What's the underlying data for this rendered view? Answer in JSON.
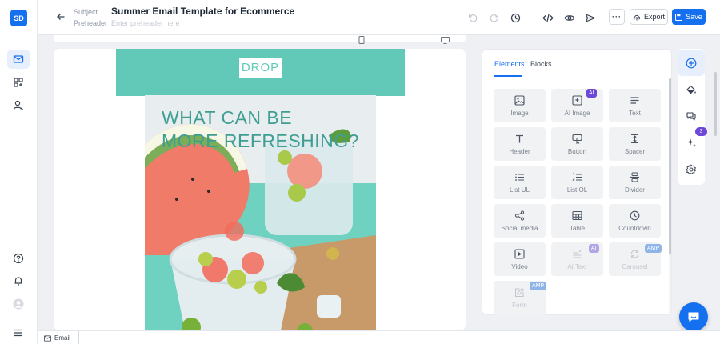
{
  "app": {
    "logo_text": "SD"
  },
  "header": {
    "subject_label": "Subject",
    "preheader_label": "Preheader",
    "title": "Summer Email Template for Ecommerce",
    "preheader_placeholder": "Enter preheader here",
    "export_label": "Export",
    "save_label": "Save",
    "more_label": "···"
  },
  "email": {
    "banner_text": "DROP",
    "headline_line1": "WHAT CAN BE",
    "headline_line2": "MORE REFRESHING?"
  },
  "panel": {
    "tabs": [
      {
        "label": "Elements",
        "active": true
      },
      {
        "label": "Blocks",
        "active": false
      }
    ],
    "elements": [
      {
        "label": "Image",
        "icon": "image-icon",
        "badge": ""
      },
      {
        "label": "AI Image",
        "icon": "ai-image-icon",
        "badge": "AI"
      },
      {
        "label": "Text",
        "icon": "text-icon",
        "badge": ""
      },
      {
        "label": "Header",
        "icon": "header-icon",
        "badge": ""
      },
      {
        "label": "Button",
        "icon": "button-icon",
        "badge": ""
      },
      {
        "label": "Spacer",
        "icon": "spacer-icon",
        "badge": ""
      },
      {
        "label": "List UL",
        "icon": "list-ul-icon",
        "badge": ""
      },
      {
        "label": "List OL",
        "icon": "list-ol-icon",
        "badge": ""
      },
      {
        "label": "Divider",
        "icon": "divider-icon",
        "badge": ""
      },
      {
        "label": "Social media",
        "icon": "share-icon",
        "badge": ""
      },
      {
        "label": "Table",
        "icon": "table-icon",
        "badge": ""
      },
      {
        "label": "Countdown",
        "icon": "clock-icon",
        "badge": ""
      },
      {
        "label": "Video",
        "icon": "video-icon",
        "badge": ""
      },
      {
        "label": "AI Text",
        "icon": "ai-text-icon",
        "badge": "AI"
      },
      {
        "label": "Carousel",
        "icon": "carousel-icon",
        "badge": "AMP"
      },
      {
        "label": "Form",
        "icon": "form-icon",
        "badge": "AMP"
      }
    ]
  },
  "rightrail": {
    "ai_badge_count": "3"
  },
  "footer": {
    "breadcrumb_label": "Email"
  },
  "colors": {
    "primary": "#1570ef",
    "banner_teal": "#62c9b9",
    "headline_teal": "#3f9e92",
    "ai_purple": "#6c47d8"
  }
}
